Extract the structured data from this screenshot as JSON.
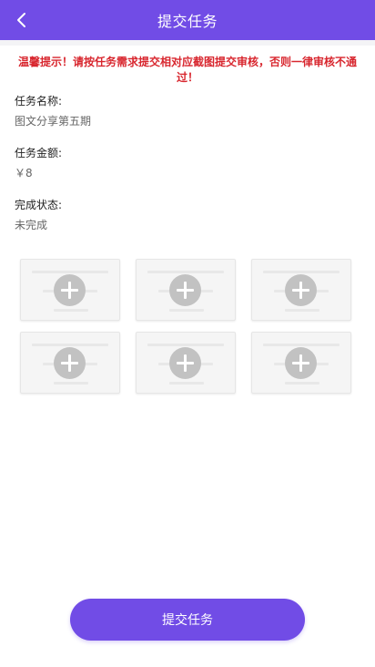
{
  "header": {
    "title": "提交任务",
    "back_icon": "chevron-left-icon",
    "background": "#714ce6"
  },
  "notice": {
    "text": "温馨提示！请按任务需求提交相对应截图提交审核，否则一律审核不通过！",
    "color": "#d8262e"
  },
  "task": {
    "name_label": "任务名称:",
    "name_value": "图文分享第五期",
    "amount_label": "任务金额:",
    "amount_value": "￥8",
    "status_label": "完成状态:",
    "status_value": "未完成"
  },
  "upload": {
    "slot_icon": "add-circle-icon",
    "slots": [
      {
        "id": 1
      },
      {
        "id": 2
      },
      {
        "id": 3
      },
      {
        "id": 4
      },
      {
        "id": 5
      },
      {
        "id": 6
      }
    ]
  },
  "actions": {
    "submit_label": "提交任务",
    "accent": "#714ce6"
  }
}
